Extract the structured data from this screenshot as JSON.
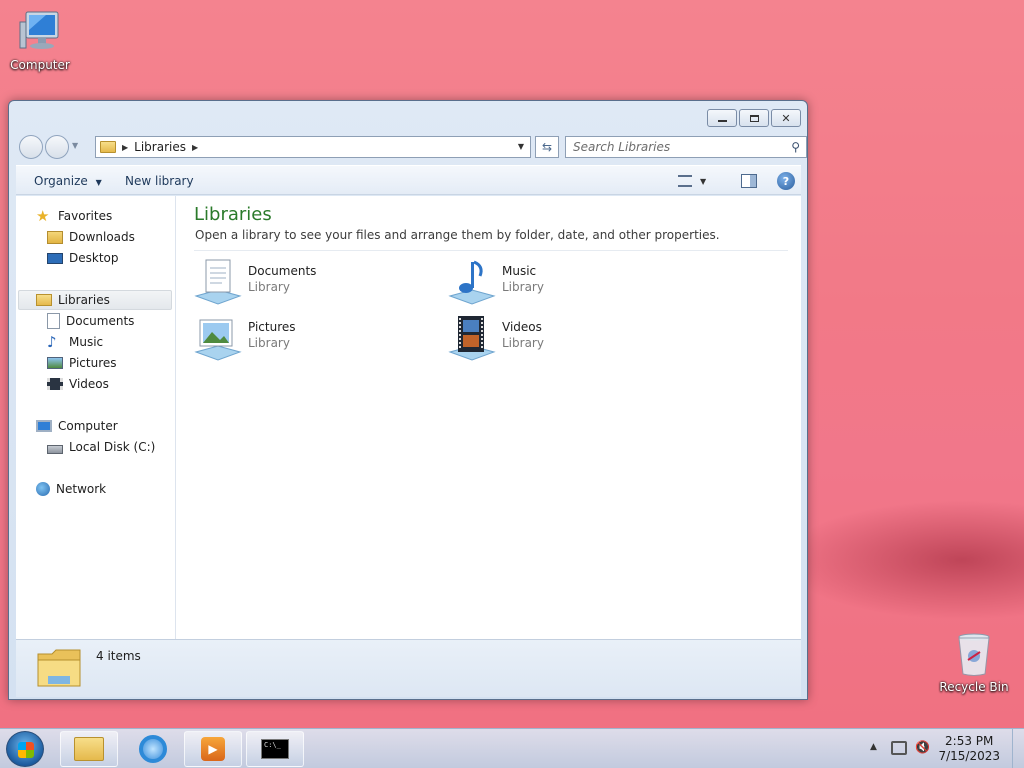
{
  "desktop": {
    "icons": [
      {
        "label": "Computer"
      },
      {
        "label": "Recycle Bin"
      }
    ]
  },
  "window": {
    "address": {
      "segments": [
        "Libraries"
      ]
    },
    "search": {
      "placeholder": "Search Libraries"
    },
    "toolbar": {
      "organize_label": "Organize",
      "new_library_label": "New library"
    },
    "nav": {
      "favorites": "Favorites",
      "downloads": "Downloads",
      "desktop": "Desktop",
      "libraries": "Libraries",
      "documents": "Documents",
      "music": "Music",
      "pictures": "Pictures",
      "videos": "Videos",
      "computer": "Computer",
      "local_disk": "Local Disk (C:)",
      "network": "Network"
    },
    "main": {
      "title": "Libraries",
      "subtitle": "Open a library to see your files and arrange them by folder, date, and other properties.",
      "items": [
        {
          "name": "Documents",
          "type": "Library",
          "icon": "documents-library-icon"
        },
        {
          "name": "Music",
          "type": "Library",
          "icon": "music-library-icon"
        },
        {
          "name": "Pictures",
          "type": "Library",
          "icon": "pictures-library-icon"
        },
        {
          "name": "Videos",
          "type": "Library",
          "icon": "videos-library-icon"
        }
      ]
    },
    "status": {
      "count": "4 items"
    }
  },
  "taskbar": {
    "time": "2:53 PM",
    "date": "7/15/2023"
  },
  "colors": {
    "desktop_bg": "#f27987",
    "title_green": "#2a7a2a",
    "toolbar_text": "#1e395b"
  }
}
